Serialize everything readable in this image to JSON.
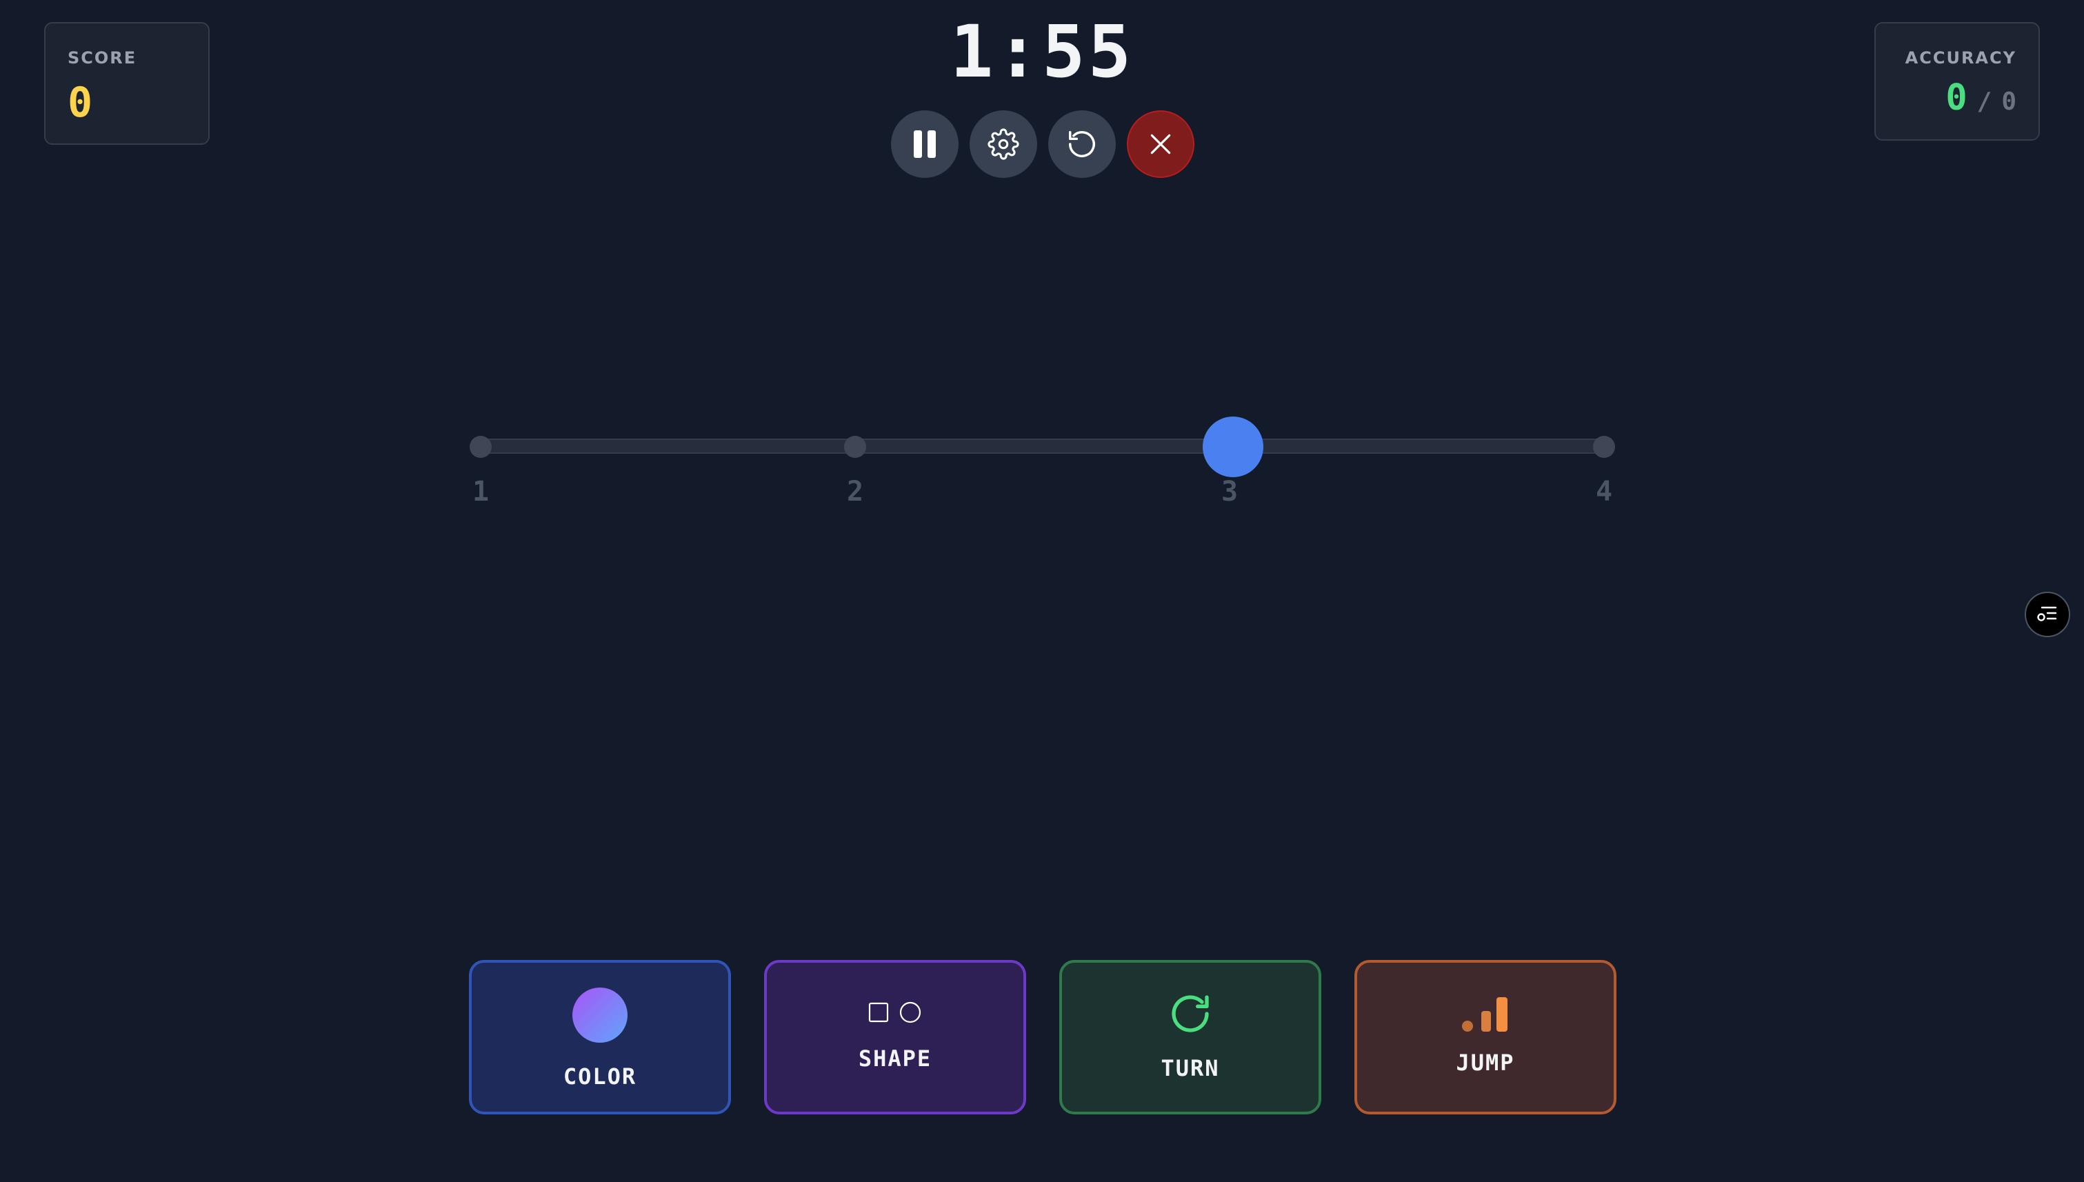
{
  "score": {
    "label": "SCORE",
    "value": "0"
  },
  "accuracy": {
    "label": "ACCURACY",
    "correct": "0",
    "separator": "/",
    "total": "0"
  },
  "timer": "1:55",
  "controls": {
    "pause_icon": "pause-icon",
    "settings_icon": "gear-icon",
    "restart_icon": "restart-icon",
    "quit_icon": "close-icon"
  },
  "slider": {
    "stops": [
      "1",
      "2",
      "3",
      "4"
    ],
    "selected": "3",
    "accent_color": "#4a80f0"
  },
  "actions": [
    {
      "label": "COLOR",
      "icon": "color-circle-icon",
      "color": "#2f55b8"
    },
    {
      "label": "SHAPE",
      "icon": "shapes-icon",
      "color": "#6d3ac8"
    },
    {
      "label": "TURN",
      "icon": "rotate-icon",
      "color": "#2f7a4a"
    },
    {
      "label": "JUMP",
      "icon": "signal-bars-icon",
      "color": "#b45a2e"
    }
  ],
  "side_button": {
    "icon": "filter-list-icon"
  }
}
